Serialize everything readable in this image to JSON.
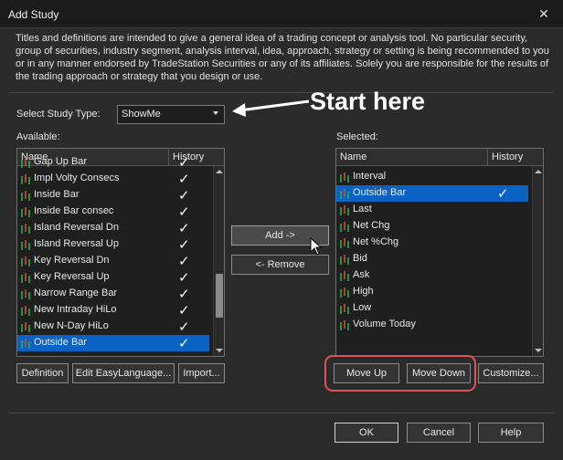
{
  "window": {
    "title": "Add Study",
    "close_glyph": "✕"
  },
  "disclaimer": "Titles and definitions are intended to give a general idea of a trading concept or analysis tool. No particular security, group of securities, industry segment, analysis interval, idea, approach, strategy or setting is being recommended to you or in any manner endorsed by TradeStation Securities or any of its affiliates. Solely you are responsible for the results of the trading approach or strategy that you design or use.",
  "study_type": {
    "label": "Select Study Type:",
    "value": "ShowMe"
  },
  "annotation": {
    "text": "Start here",
    "color": "#ffffff"
  },
  "available": {
    "label": "Available:",
    "columns": {
      "name": "Name",
      "history": "History"
    },
    "partial_top_row": "Gap Up Bar",
    "items": [
      {
        "name": "Impl Volty Consecs",
        "history": "✓"
      },
      {
        "name": "Inside Bar",
        "history": "✓"
      },
      {
        "name": "Inside Bar consec",
        "history": "✓"
      },
      {
        "name": "Island Reversal Dn",
        "history": "✓"
      },
      {
        "name": "Island Reversal Up",
        "history": "✓"
      },
      {
        "name": "Key Reversal Dn",
        "history": "✓"
      },
      {
        "name": "Key Reversal Up",
        "history": "✓"
      },
      {
        "name": "Narrow Range Bar",
        "history": "✓"
      },
      {
        "name": "New Intraday HiLo",
        "history": "✓"
      },
      {
        "name": "New N-Day HiLo",
        "history": "✓"
      },
      {
        "name": "Outside Bar",
        "history": "✓",
        "selected": true
      }
    ]
  },
  "selected": {
    "label": "Selected:",
    "columns": {
      "name": "Name",
      "history": "History"
    },
    "items": [
      {
        "name": "Interval",
        "history": ""
      },
      {
        "name": "Outside Bar",
        "history": "✓",
        "selected": true
      },
      {
        "name": "Last",
        "history": ""
      },
      {
        "name": "Net Chg",
        "history": ""
      },
      {
        "name": "Net %Chg",
        "history": ""
      },
      {
        "name": "Bid",
        "history": ""
      },
      {
        "name": "Ask",
        "history": ""
      },
      {
        "name": "High",
        "history": ""
      },
      {
        "name": "Low",
        "history": ""
      },
      {
        "name": "Volume Today",
        "history": ""
      }
    ]
  },
  "buttons": {
    "add": "Add ->",
    "remove": "<- Remove",
    "definition": "Definition",
    "edit_easylanguage": "Edit EasyLanguage...",
    "import": "Import...",
    "move_up": "Move Up",
    "move_down": "Move Down",
    "customize": "Customize...",
    "ok": "OK",
    "cancel": "Cancel",
    "help": "Help"
  },
  "colors": {
    "selection": "#0a63c4",
    "highlight_ring": "#e05353",
    "icon_green": "#22b14c",
    "icon_red": "#e8412c"
  }
}
